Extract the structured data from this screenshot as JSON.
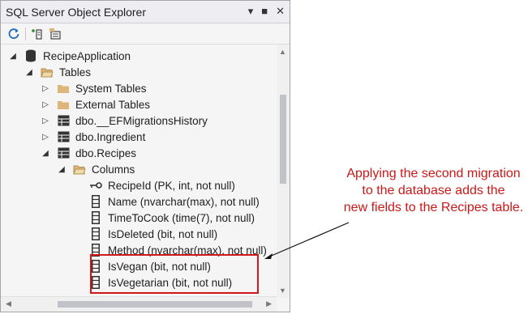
{
  "panel": {
    "title": "SQL Server Object Explorer",
    "controls": {
      "dropdown": "▾",
      "maximize": "■",
      "close": "✕"
    }
  },
  "toolbar": {
    "buttons": [
      {
        "icon": "refresh-icon"
      },
      {
        "icon": "add-sql-server-icon"
      },
      {
        "icon": "filter-icon"
      }
    ]
  },
  "tree": {
    "database": "RecipeApplication",
    "tables_folder": "Tables",
    "system_tables": "System Tables",
    "external_tables": "External Tables",
    "tables": [
      "dbo.__EFMigrationsHistory",
      "dbo.Ingredient",
      "dbo.Recipes"
    ],
    "columns_folder": "Columns",
    "columns": [
      {
        "label": "RecipeId (PK, int, not null)",
        "icon": "primary-key-icon"
      },
      {
        "label": "Name (nvarchar(max), not null)",
        "icon": "column-icon"
      },
      {
        "label": "TimeToCook (time(7), not null)",
        "icon": "column-icon"
      },
      {
        "label": "IsDeleted (bit, not null)",
        "icon": "column-icon"
      },
      {
        "label": "Method (nvarchar(max), not null)",
        "icon": "column-icon"
      },
      {
        "label": "IsVegan (bit, not null)",
        "icon": "column-icon"
      },
      {
        "label": "IsVegetarian (bit, not null)",
        "icon": "column-icon"
      }
    ]
  },
  "annotation": {
    "line1": "Applying the second migration",
    "line2": "to the database adds the",
    "line3": "new fields to the Recipes table."
  },
  "colors": {
    "annotation": "#cc1818",
    "folder": "#dcb67a",
    "highlight_border": "#d01818"
  }
}
